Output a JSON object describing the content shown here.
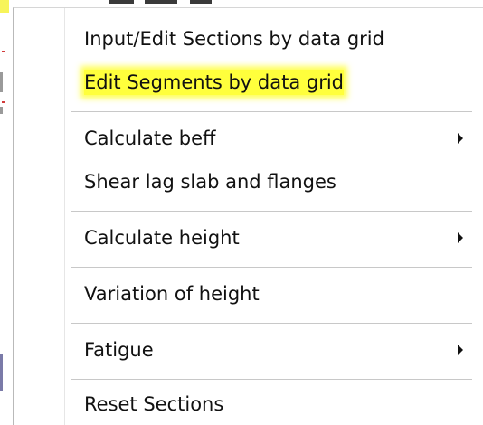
{
  "menu": {
    "items": [
      {
        "label": "Input/Edit Sections by data grid",
        "has_submenu": false,
        "highlighted": false
      },
      {
        "label": "Edit Segments by data grid",
        "has_submenu": false,
        "highlighted": true
      },
      {
        "label": "Calculate beff",
        "has_submenu": true,
        "highlighted": false
      },
      {
        "label": "Shear lag slab and flanges",
        "has_submenu": false,
        "highlighted": false
      },
      {
        "label": "Calculate height",
        "has_submenu": true,
        "highlighted": false
      },
      {
        "label": "Variation of height",
        "has_submenu": false,
        "highlighted": false
      },
      {
        "label": "Fatigue",
        "has_submenu": true,
        "highlighted": false
      },
      {
        "label": "Reset Sections",
        "has_submenu": false,
        "highlighted": false
      }
    ],
    "submenu_arrow_icon": "chevron-right-icon",
    "highlight_color": "#ffff3c"
  }
}
